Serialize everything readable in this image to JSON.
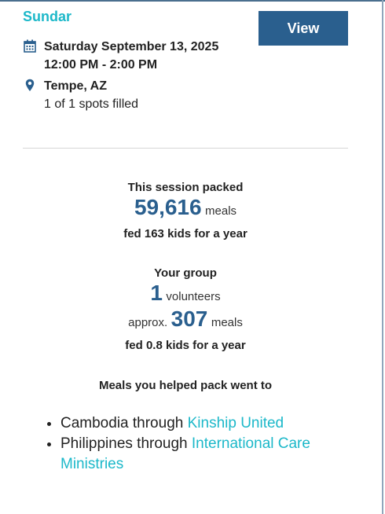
{
  "session": {
    "group_name": "Sundar",
    "view_button_label": "View",
    "date": "Saturday September 13, 2025",
    "time": "12:00 PM - 2:00 PM",
    "location": "Tempe, AZ",
    "spots": "1 of 1 spots filled",
    "icons": {
      "date": "calendar-icon",
      "location": "map-pin-icon"
    }
  },
  "session_stats": {
    "heading": "This session packed",
    "meals_count": "59,616",
    "meals_unit": "meals",
    "kids_fed": "fed 163 kids for a year"
  },
  "group_stats": {
    "heading": "Your group",
    "volunteers_count": "1",
    "volunteers_unit": "volunteers",
    "approx_prefix": "approx.",
    "meals_count": "307",
    "meals_unit": "meals",
    "kids_fed": "fed 0.8 kids for a year"
  },
  "destinations": {
    "heading": "Meals you helped pack went to",
    "items": [
      {
        "country_text": "Cambodia through",
        "org_link": "Kinship United"
      },
      {
        "country_text": "Philippines through",
        "org_link": "International Care Ministries"
      }
    ]
  },
  "colors": {
    "accent_teal": "#1cb8c9",
    "primary_blue": "#2a5f8e",
    "text_dark": "#222222",
    "divider": "#d5d5d5"
  }
}
